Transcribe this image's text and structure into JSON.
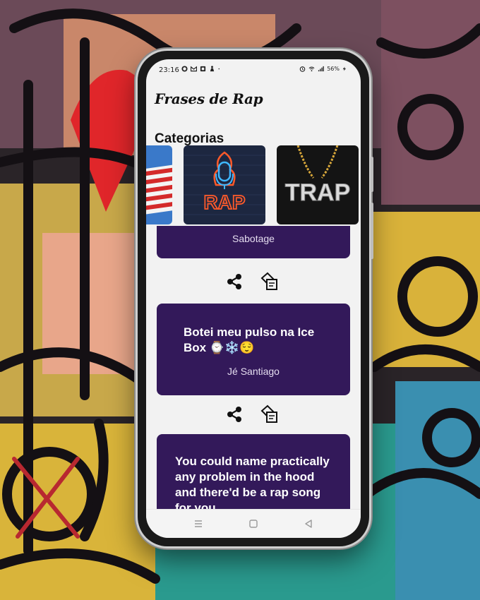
{
  "status_bar": {
    "time": "23:16",
    "battery": "56%"
  },
  "app": {
    "title": "Frases de Rap"
  },
  "categories": {
    "heading": "Categorias",
    "items": [
      {
        "icon": "us-flag-image"
      },
      {
        "label": "RAP",
        "icon": "neon-rap-microphone-image"
      },
      {
        "label": "TRAP",
        "icon": "trap-chain-image"
      }
    ]
  },
  "quotes": [
    {
      "author": "Sabotage"
    },
    {
      "text": "Botei meu pulso na Ice Box ⌚❄️😌",
      "author": "Jé Santiago"
    },
    {
      "text": "You could name practically any problem in the hood and there'd be a rap song for you."
    }
  ],
  "colors": {
    "card": "#33195a",
    "screen": "#f2f2f2",
    "neon": "#ff5a2a",
    "neon_blue": "#3fb7ff"
  },
  "actions": {
    "share_icon": "share-icon",
    "copy_icon": "copy-icon"
  },
  "navbar": {
    "menu_icon": "menu-icon",
    "home_icon": "home-icon",
    "back_icon": "back-icon"
  }
}
